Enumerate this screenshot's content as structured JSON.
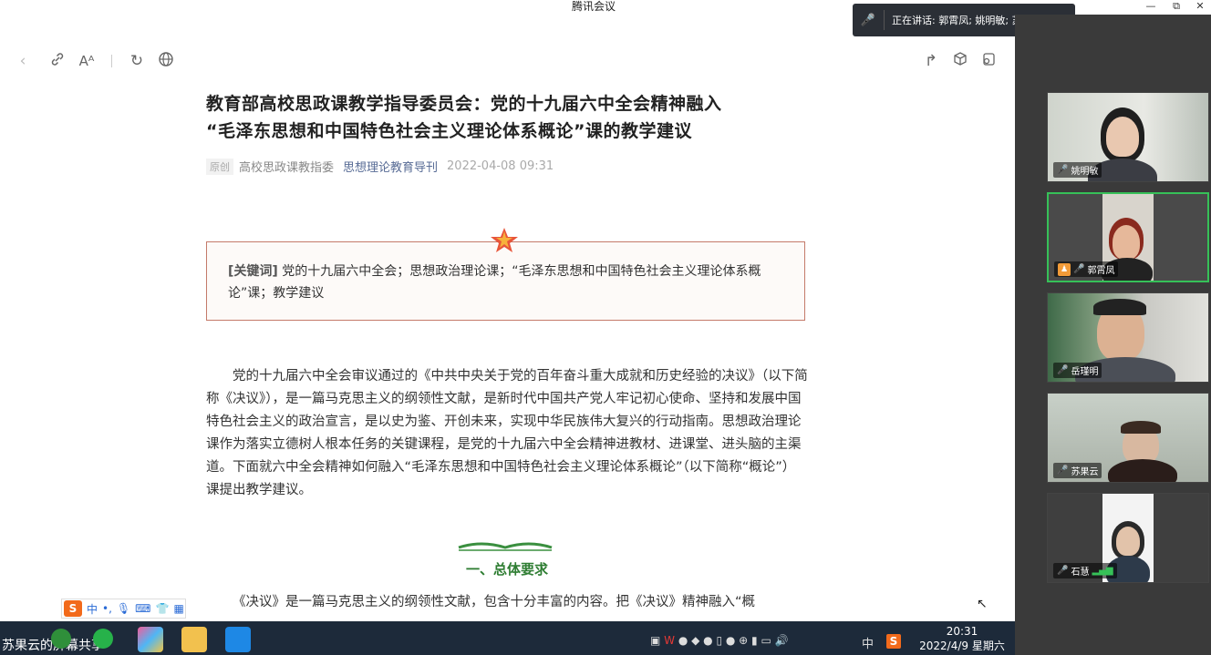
{
  "window": {
    "title": "腾讯会议",
    "minimize": "—",
    "maximize": "⧉",
    "close": "✕"
  },
  "speaker": {
    "text": "正在讲话: 郭霄凤; 姚明敏; 苏果..."
  },
  "browser": {
    "toolbar": [
      "back-icon",
      "link-icon",
      "font-size-icon",
      "refresh-icon",
      "globe-icon",
      "share-icon",
      "cube-icon",
      "settings-icon"
    ]
  },
  "article": {
    "title_line1": "教育部高校思政课教学指导委员会：党的十九届六中全会精神融入",
    "title_line2": "“毛泽东思想和中国特色社会主义理论体系概论”课的教学建议",
    "tag": "原创",
    "author": "高校思政课教指委",
    "account": "思想理论教育导刊",
    "date": "2022-04-08 09:31",
    "keywords_label": "[关键词]",
    "keywords_text": "党的十九届六中全会；思想政治理论课；“毛泽东思想和中国特色社会主义理论体系概论”课；教学建议",
    "paragraph1": "党的十九届六中全会审议通过的《中共中央关于党的百年奋斗重大成就和历史经验的决议》（以下简称《决议》），是一篇马克思主义的纲领性文献，是新时代中国共产党人牢记初心使命、坚持和发展中国特色社会主义的政治宣言，是以史为鉴、开创未来，实现中华民族伟大复兴的行动指南。思想政治理论课作为落实立德树人根本任务的关键课程，是党的十九届六中全会精神进教材、进课堂、进头脑的主渠道。下面就六中全会精神如何融入“毛泽东思想和中国特色社会主义理论体系概论”（以下简称“概论”）课提出教学建议。",
    "section_title": "一、总体要求",
    "paragraph2": "《决议》是一篇马克思主义的纲领性文献，包含十分丰富的内容。把《决议》精神融入“概"
  },
  "ime": {
    "logo": "S",
    "mode": "中",
    "punct": "•,",
    "mic": "mic-icon",
    "keyboard": "keyboard-icon",
    "shirt": "skin-icon",
    "grid": "menu-icon"
  },
  "participants": [
    {
      "name": "姚明敏",
      "active": false
    },
    {
      "name": "郭霄凤",
      "active": true,
      "host": true
    },
    {
      "name": "岳瑾明",
      "active": false
    },
    {
      "name": "苏果云",
      "active": false
    },
    {
      "name": "石慧",
      "active": false
    }
  ],
  "taskbar": {
    "share_label": "苏果云的屏幕共享",
    "ime_indicator": "中",
    "time": "20:31",
    "date": "2022/4/9 星期六"
  },
  "colors": {
    "green_active": "#36c158",
    "account_blue": "#576b95",
    "keyword_border": "#c47a6a",
    "section_green": "#2e7d32"
  }
}
